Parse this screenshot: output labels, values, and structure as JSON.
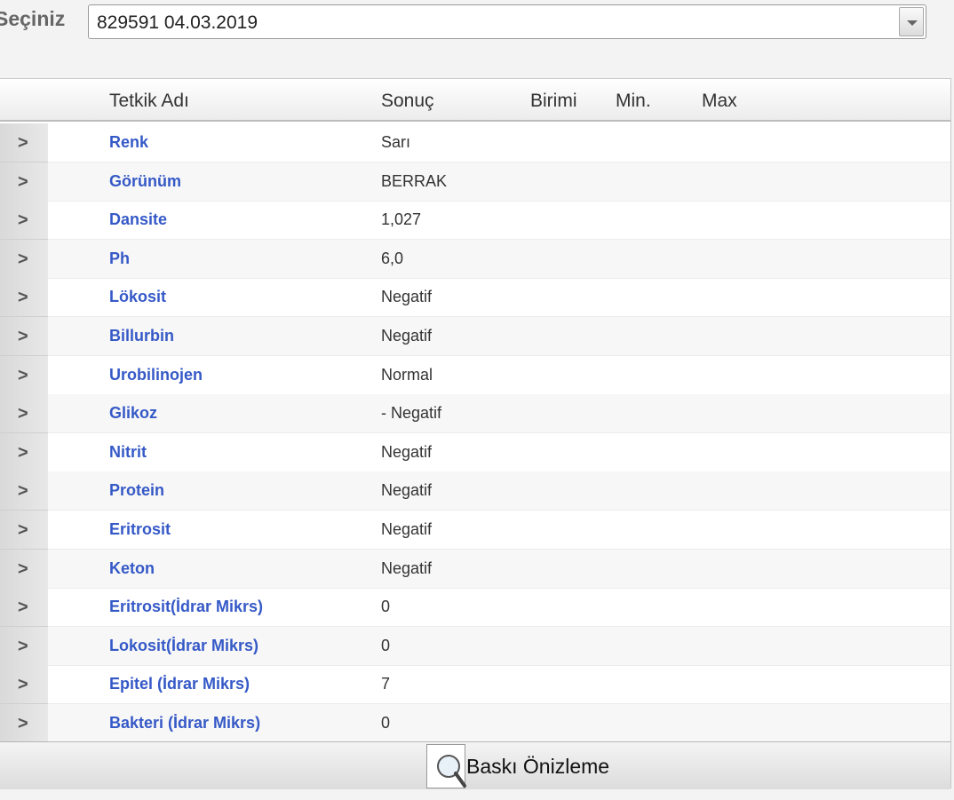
{
  "selector": {
    "label": "Seçiniz",
    "value": "829591 04.03.2019"
  },
  "grid": {
    "headers": {
      "name": "Tetkik Adı",
      "result": "Sonuç",
      "unit": "Birimi",
      "min": "Min.",
      "max": "Max"
    },
    "rows": [
      {
        "name": "Renk",
        "result": "Sarı"
      },
      {
        "name": "Görünüm",
        "result": "BERRAK"
      },
      {
        "name": "Dansite",
        "result": "1,027"
      },
      {
        "name": "Ph",
        "result": "6,0"
      },
      {
        "name": "Lökosit",
        "result": "Negatif"
      },
      {
        "name": "Billurbin",
        "result": "Negatif"
      },
      {
        "name": "Urobilinojen",
        "result": "Normal"
      },
      {
        "name": "Glikoz",
        "result": "- Negatif"
      },
      {
        "name": "Nitrit",
        "result": "Negatif"
      },
      {
        "name": "Protein",
        "result": "Negatif"
      },
      {
        "name": "Eritrosit",
        "result": "Negatif"
      },
      {
        "name": "Keton",
        "result": "Negatif"
      },
      {
        "name": "Eritrosit(İdrar Mikrs)",
        "result": "0"
      },
      {
        "name": "Lokosit(İdrar Mikrs)",
        "result": "0"
      },
      {
        "name": "Epitel (İdrar Mikrs)",
        "result": "7"
      },
      {
        "name": "Bakteri (İdrar Mikrs)",
        "result": "0"
      }
    ],
    "row_expander_icon": "chevron-right-icon"
  },
  "footer": {
    "print_preview_label": "Baskı Önizleme",
    "print_preview_icon": "magnifier-document-icon"
  }
}
